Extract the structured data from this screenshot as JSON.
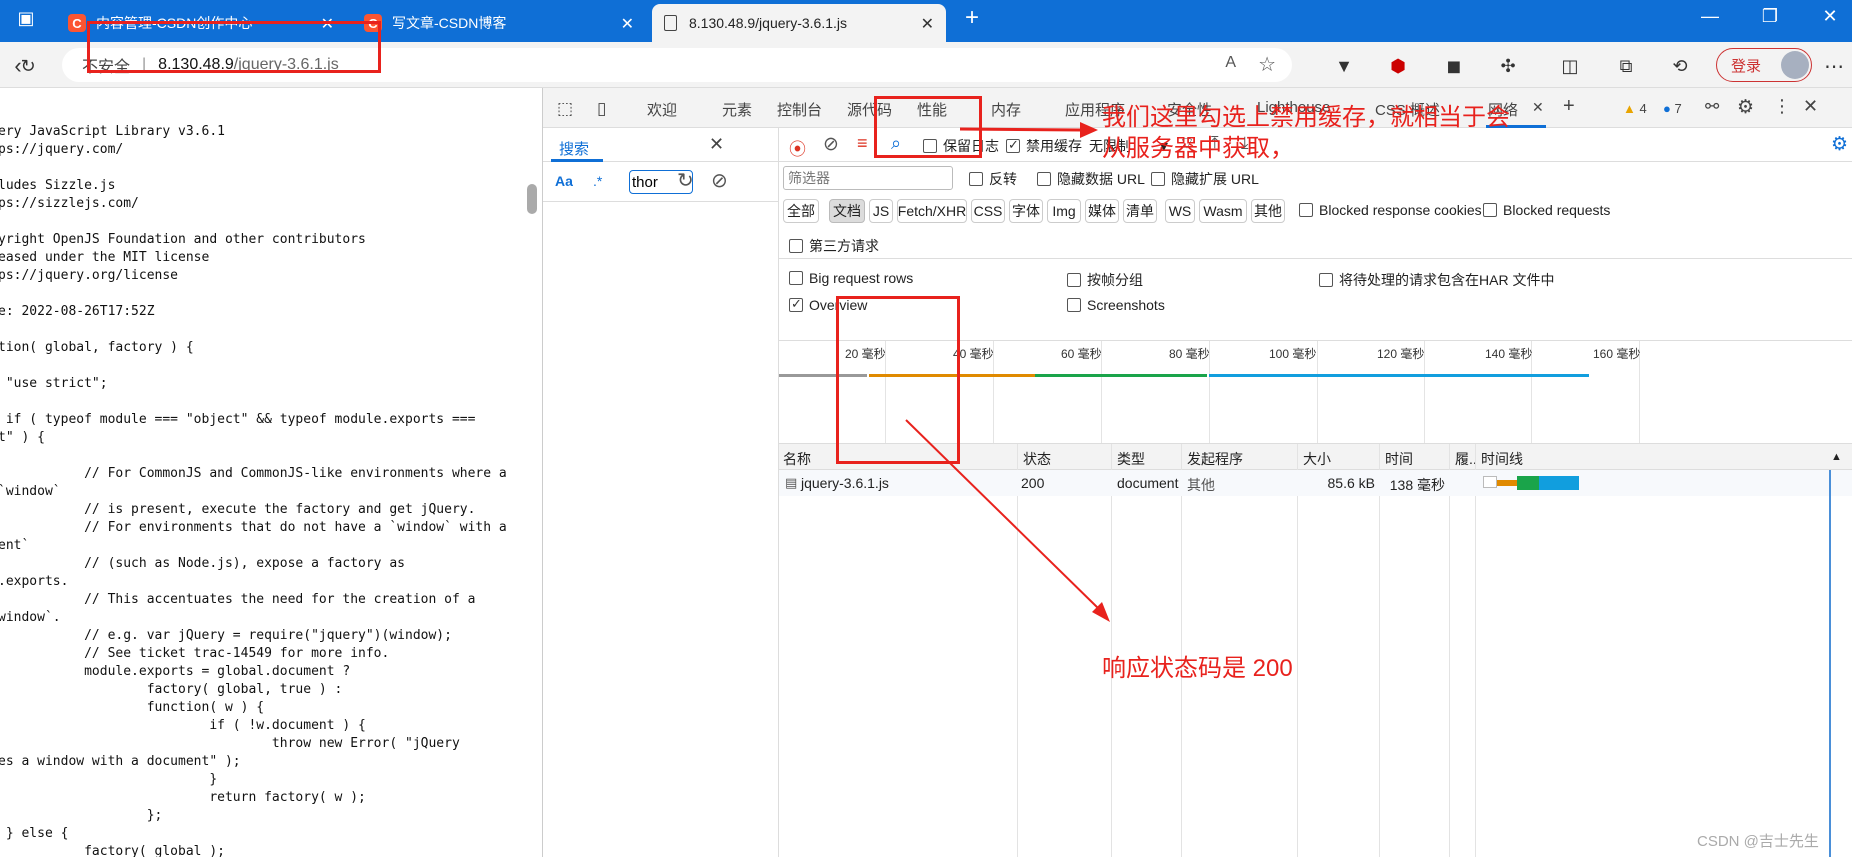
{
  "browser": {
    "tabs": [
      {
        "title": "内容管理-CSDN创作中心",
        "icon": "csdn-icon"
      },
      {
        "title": "写文章-CSDN博客",
        "icon": "csdn-icon"
      },
      {
        "title": "8.130.48.9/jquery-3.6.1.js",
        "icon": "document-icon"
      }
    ],
    "new_tab": "+",
    "address": {
      "security": "不安全",
      "host": "8.130.48.9",
      "path": "/jquery-3.6.1.js"
    },
    "login_label": "登录"
  },
  "source_text": "ery JavaScript Library v3.6.1\nps://jquery.com/\n\nludes Sizzle.js\nps://sizzlejs.com/\n\nyright OpenJS Foundation and other contributors\neased under the MIT license\nps://jquery.org/license\n\ne: 2022-08-26T17:52Z\n\ntion( global, factory ) {\n\n \"use strict\";\n\n if ( typeof module === \"object\" && typeof module.exports ===\nt\" ) {\n\n           // For CommonJS and CommonJS-like environments where a\n`window`\n           // is present, execute the factory and get jQuery.\n           // For environments that do not have a `window` with a\nent`\n           // (such as Node.js), expose a factory as\n.exports.\n           // This accentuates the need for the creation of a\nwindow`.\n           // e.g. var jQuery = require(\"jquery\")(window);\n           // See ticket trac-14549 for more info.\n           module.exports = global.document ?\n                   factory( global, true ) :\n                   function( w ) {\n                           if ( !w.document ) {\n                                   throw new Error( \"jQuery\nes a window with a document\" );\n                           }\n                           return factory( w );\n                   };\n } else {\n           factory( global );",
  "devtools": {
    "tabs": [
      "欢迎",
      "元素",
      "控制台",
      "源代码",
      "性能",
      "内存",
      "应用程序",
      "安全性",
      "Lighthouse",
      "CSS 概述",
      "网络"
    ],
    "active_tab": "网络",
    "warnings": "4",
    "messages": "7",
    "search": {
      "tab_label": "搜索",
      "case_label": "Aa",
      "regex_label": ".*",
      "query": "thor"
    },
    "network": {
      "preserve_log": "保留日志",
      "disable_cache": "禁用缓存",
      "disable_cache_checked": true,
      "throttling": "无限制",
      "filter_placeholder": "筛选器",
      "invert": "反转",
      "hide_data_urls": "隐藏数据 URL",
      "hide_ext_urls": "隐藏扩展 URL",
      "type_filters": [
        "全部",
        "文档",
        "JS",
        "Fetch/XHR",
        "CSS",
        "字体",
        "Img",
        "媒体",
        "清单",
        "WS",
        "Wasm",
        "其他"
      ],
      "type_filter_selected": "文档",
      "blocked_cookies": "Blocked response cookies",
      "blocked_requests": "Blocked requests",
      "third_party": "第三方请求",
      "big_rows": "Big request rows",
      "group_by_frame": "按帧分组",
      "har_pending": "将待处理的请求包含在HAR 文件中",
      "overview": "Overview",
      "overview_checked": true,
      "screenshots": "Screenshots",
      "ticks": [
        "20 毫秒",
        "40 毫秒",
        "60 毫秒",
        "80 毫秒",
        "100 毫秒",
        "120 毫秒",
        "140 毫秒",
        "160 毫秒"
      ],
      "columns": [
        "名称",
        "状态",
        "类型",
        "发起程序",
        "大小",
        "时间",
        "履..",
        "时间线"
      ],
      "rows": [
        {
          "name": "jquery-3.6.1.js",
          "status": "200",
          "type": "document",
          "initiator": "其他",
          "size": "85.6 kB",
          "time": "138 毫秒"
        }
      ]
    }
  },
  "annotations": {
    "cache_note_line1": "我们这里勾选上禁用缓存，就相当于会",
    "cache_note_line2": "从服务器中获取，",
    "status_note": "响应状态码是 200"
  },
  "watermark": "CSDN @吉士先生",
  "colors": {
    "browser_blue": "#0f6fd6",
    "annotation_red": "#e8221d",
    "csdn_orange": "#fc5531"
  }
}
